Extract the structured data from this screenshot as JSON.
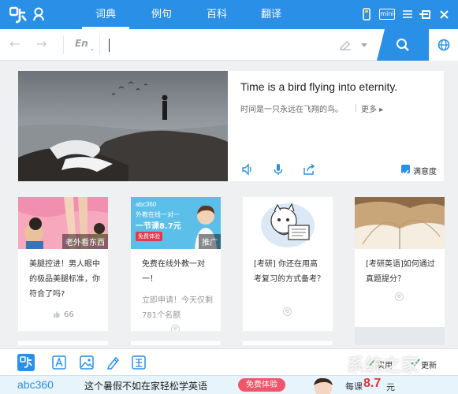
{
  "nav": {
    "tabs": [
      {
        "label": "词典",
        "active": true
      },
      {
        "label": "例句",
        "active": false
      },
      {
        "label": "百科",
        "active": false
      },
      {
        "label": "翻译",
        "active": false
      }
    ],
    "mini_label": "mini"
  },
  "search": {
    "lang": "En",
    "value": "",
    "placeholder": ""
  },
  "hero": {
    "title": "Time is a bird flying into eternity.",
    "subtitle": "时间是一只永远在飞翔的鸟。",
    "more_label": "更多 ▸",
    "satisfaction_label": "满意度"
  },
  "cards": [
    {
      "title": "美腿控进！男人眼中的极品美腿标准，你符合了吗?",
      "tag": "老外看东西",
      "likes": "66"
    },
    {
      "title": "免费在线外教一对一！",
      "brand": "abc360",
      "promo_line1": "外教在线一对一",
      "promo_line2": "一节课8.7元",
      "promo_btn": "免费体验",
      "desc": "立即申请！今天仅剩781个名额",
      "tag": "推广"
    },
    {
      "title": "[考研] 你还在用高考复习的方式备考？"
    },
    {
      "title": "[考研英语]如何通过真题提分？"
    }
  ],
  "toolbar": {
    "labels": [
      "实用",
      "更新"
    ]
  },
  "ad": {
    "brand": "abc360",
    "text": "这个暑假不如在家轻松学英语",
    "button": "免费体验",
    "price_label": "每课",
    "price": "8.7",
    "unit": "元"
  },
  "watermark": "系统之家",
  "colors": {
    "accent": "#2a8fe6",
    "ad_button": "#f0556a",
    "price": "#e0333a"
  }
}
